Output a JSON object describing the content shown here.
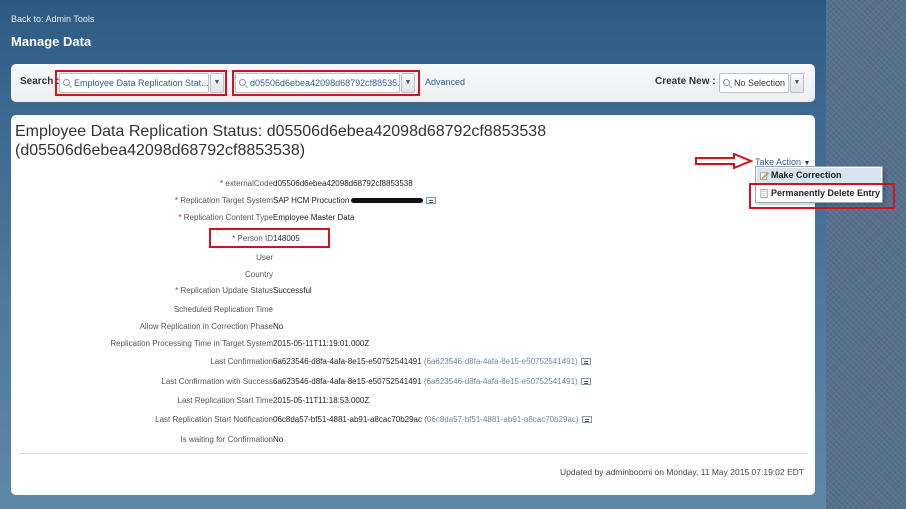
{
  "nav": {
    "back_link": "Back to: Admin Tools",
    "page_title": "Manage Data"
  },
  "search": {
    "label": "Search :",
    "type_value": "Employee Data Replication Stat...",
    "id_value": "d05506d6ebea42098d68792cf88535...",
    "advanced_link": "Advanced",
    "create_label": "Create New :",
    "create_value": "No Selection"
  },
  "record": {
    "heading": "Employee Data Replication Status: d05506d6ebea42098d68792cf8853538 (d05506d6ebea42098d68792cf8853538)",
    "take_action": "Take Action",
    "menu": [
      "Make Correction",
      "Permanently Delete Entry"
    ],
    "fields": [
      {
        "label": "externalCode",
        "required": "*",
        "value": "d05506d6ebea42098d68792cf8853538",
        "secondary": ""
      },
      {
        "label": "Replication Target System",
        "required": "*",
        "value": "SAP HCM Procuction",
        "secondary": ""
      },
      {
        "label": "Replication Content Type",
        "required": "*",
        "value": "Employee Master Data",
        "secondary": ""
      },
      {
        "label": "Person ID",
        "required": "*",
        "value": "148005",
        "secondary": ""
      },
      {
        "label": "User",
        "required": "",
        "value": "",
        "secondary": ""
      },
      {
        "label": "Country",
        "required": "",
        "value": "",
        "secondary": ""
      },
      {
        "label": "Replication Update Status",
        "required": "*",
        "value": "Successful",
        "secondary": ""
      },
      {
        "label": "Scheduled Replication Time",
        "required": "",
        "value": "",
        "secondary": ""
      },
      {
        "label": "Allow Replication in Correction Phase",
        "required": "",
        "value": "No",
        "secondary": ""
      },
      {
        "label": "Replication Processing Time in Target System",
        "required": "",
        "value": "2015-05-11T11:19:01.000Z",
        "secondary": ""
      },
      {
        "label": "Last Confirmation",
        "required": "",
        "value": "6a623546-d8fa-4afa-8e15-e50752541491",
        "secondary": "(6a623546-d8fa-4afa-8e15-e50752541491)"
      },
      {
        "label": "Last Confirmation with Success",
        "required": "",
        "value": "6a623546-d8fa-4afa-8e15-e50752541491",
        "secondary": "(6a623546-d8fa-4afa-8e15-e50752541491)"
      },
      {
        "label": "Last Replication Start Time",
        "required": "",
        "value": "2015-05-11T11:18:53.000Z",
        "secondary": ""
      },
      {
        "label": "Last Replication Start Notification",
        "required": "",
        "value": "06c8da57-bf51-4881-ab91-a8cac70b29ac",
        "secondary": "(06c8da57-bf51-4881-ab91-a8cac70b29ac)"
      },
      {
        "label": "Is waiting for Confirmation",
        "required": "",
        "value": "No",
        "secondary": ""
      }
    ],
    "footer": "Updated by adminboomi on Monday, 11 May 2015 07:19:02 EDT"
  },
  "colors": {
    "highlight_box": "#d4121b",
    "link": "#2f5f92",
    "required_marker": "#d0181e"
  }
}
